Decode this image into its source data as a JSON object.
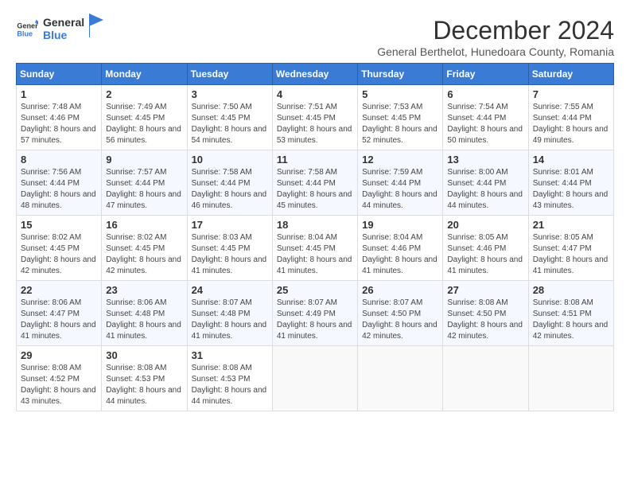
{
  "logo": {
    "general": "General",
    "blue": "Blue"
  },
  "title": "December 2024",
  "subtitle": "General Berthelot, Hunedoara County, Romania",
  "days_of_week": [
    "Sunday",
    "Monday",
    "Tuesday",
    "Wednesday",
    "Thursday",
    "Friday",
    "Saturday"
  ],
  "weeks": [
    [
      {
        "day": "1",
        "sunrise": "7:48 AM",
        "sunset": "4:46 PM",
        "daylight": "8 hours and 57 minutes."
      },
      {
        "day": "2",
        "sunrise": "7:49 AM",
        "sunset": "4:45 PM",
        "daylight": "8 hours and 56 minutes."
      },
      {
        "day": "3",
        "sunrise": "7:50 AM",
        "sunset": "4:45 PM",
        "daylight": "8 hours and 54 minutes."
      },
      {
        "day": "4",
        "sunrise": "7:51 AM",
        "sunset": "4:45 PM",
        "daylight": "8 hours and 53 minutes."
      },
      {
        "day": "5",
        "sunrise": "7:53 AM",
        "sunset": "4:45 PM",
        "daylight": "8 hours and 52 minutes."
      },
      {
        "day": "6",
        "sunrise": "7:54 AM",
        "sunset": "4:44 PM",
        "daylight": "8 hours and 50 minutes."
      },
      {
        "day": "7",
        "sunrise": "7:55 AM",
        "sunset": "4:44 PM",
        "daylight": "8 hours and 49 minutes."
      }
    ],
    [
      {
        "day": "8",
        "sunrise": "7:56 AM",
        "sunset": "4:44 PM",
        "daylight": "8 hours and 48 minutes."
      },
      {
        "day": "9",
        "sunrise": "7:57 AM",
        "sunset": "4:44 PM",
        "daylight": "8 hours and 47 minutes."
      },
      {
        "day": "10",
        "sunrise": "7:58 AM",
        "sunset": "4:44 PM",
        "daylight": "8 hours and 46 minutes."
      },
      {
        "day": "11",
        "sunrise": "7:58 AM",
        "sunset": "4:44 PM",
        "daylight": "8 hours and 45 minutes."
      },
      {
        "day": "12",
        "sunrise": "7:59 AM",
        "sunset": "4:44 PM",
        "daylight": "8 hours and 44 minutes."
      },
      {
        "day": "13",
        "sunrise": "8:00 AM",
        "sunset": "4:44 PM",
        "daylight": "8 hours and 44 minutes."
      },
      {
        "day": "14",
        "sunrise": "8:01 AM",
        "sunset": "4:44 PM",
        "daylight": "8 hours and 43 minutes."
      }
    ],
    [
      {
        "day": "15",
        "sunrise": "8:02 AM",
        "sunset": "4:45 PM",
        "daylight": "8 hours and 42 minutes."
      },
      {
        "day": "16",
        "sunrise": "8:02 AM",
        "sunset": "4:45 PM",
        "daylight": "8 hours and 42 minutes."
      },
      {
        "day": "17",
        "sunrise": "8:03 AM",
        "sunset": "4:45 PM",
        "daylight": "8 hours and 41 minutes."
      },
      {
        "day": "18",
        "sunrise": "8:04 AM",
        "sunset": "4:45 PM",
        "daylight": "8 hours and 41 minutes."
      },
      {
        "day": "19",
        "sunrise": "8:04 AM",
        "sunset": "4:46 PM",
        "daylight": "8 hours and 41 minutes."
      },
      {
        "day": "20",
        "sunrise": "8:05 AM",
        "sunset": "4:46 PM",
        "daylight": "8 hours and 41 minutes."
      },
      {
        "day": "21",
        "sunrise": "8:05 AM",
        "sunset": "4:47 PM",
        "daylight": "8 hours and 41 minutes."
      }
    ],
    [
      {
        "day": "22",
        "sunrise": "8:06 AM",
        "sunset": "4:47 PM",
        "daylight": "8 hours and 41 minutes."
      },
      {
        "day": "23",
        "sunrise": "8:06 AM",
        "sunset": "4:48 PM",
        "daylight": "8 hours and 41 minutes."
      },
      {
        "day": "24",
        "sunrise": "8:07 AM",
        "sunset": "4:48 PM",
        "daylight": "8 hours and 41 minutes."
      },
      {
        "day": "25",
        "sunrise": "8:07 AM",
        "sunset": "4:49 PM",
        "daylight": "8 hours and 41 minutes."
      },
      {
        "day": "26",
        "sunrise": "8:07 AM",
        "sunset": "4:50 PM",
        "daylight": "8 hours and 42 minutes."
      },
      {
        "day": "27",
        "sunrise": "8:08 AM",
        "sunset": "4:50 PM",
        "daylight": "8 hours and 42 minutes."
      },
      {
        "day": "28",
        "sunrise": "8:08 AM",
        "sunset": "4:51 PM",
        "daylight": "8 hours and 42 minutes."
      }
    ],
    [
      {
        "day": "29",
        "sunrise": "8:08 AM",
        "sunset": "4:52 PM",
        "daylight": "8 hours and 43 minutes."
      },
      {
        "day": "30",
        "sunrise": "8:08 AM",
        "sunset": "4:53 PM",
        "daylight": "8 hours and 44 minutes."
      },
      {
        "day": "31",
        "sunrise": "8:08 AM",
        "sunset": "4:53 PM",
        "daylight": "8 hours and 44 minutes."
      },
      null,
      null,
      null,
      null
    ]
  ],
  "labels": {
    "sunrise": "Sunrise:",
    "sunset": "Sunset:",
    "daylight": "Daylight:"
  }
}
